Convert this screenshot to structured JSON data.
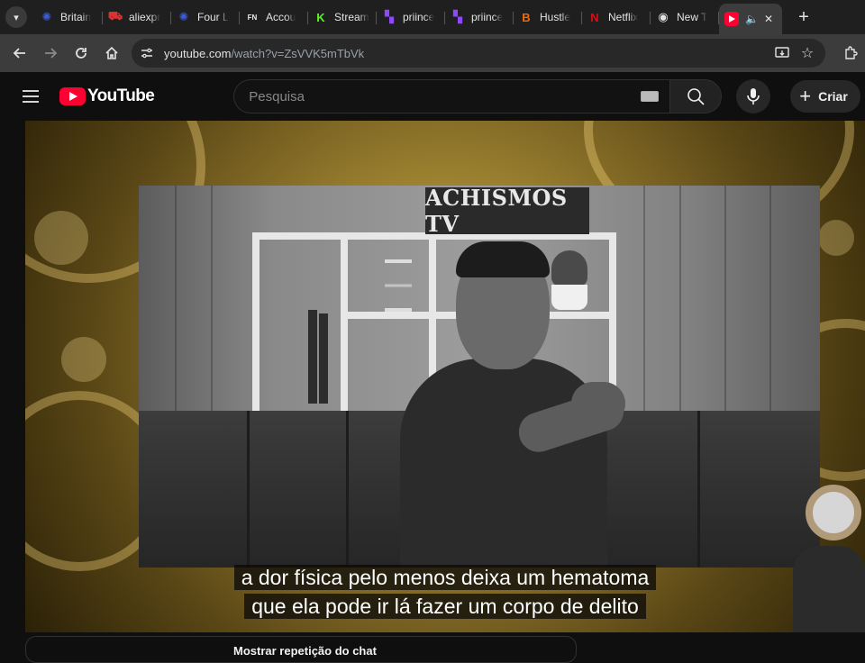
{
  "browser": {
    "tabs": [
      {
        "label": "Britain",
        "favicon": "globe-icon",
        "color": "#3b5bdb"
      },
      {
        "label": "aliexpr",
        "favicon": "cart-icon",
        "color": "#e03131"
      },
      {
        "label": "Four L",
        "favicon": "globe-icon",
        "color": "#3b5bdb"
      },
      {
        "label": "Accou",
        "favicon": "fn-icon",
        "color": "#e9ecef"
      },
      {
        "label": "Stream",
        "favicon": "kick-icon",
        "color": "#53fc18"
      },
      {
        "label": "priince",
        "favicon": "twitch-icon",
        "color": "#9146ff"
      },
      {
        "label": "priince",
        "favicon": "twitch-icon",
        "color": "#9146ff"
      },
      {
        "label": "Hustle",
        "favicon": "blogger-icon",
        "color": "#f76707"
      },
      {
        "label": "Netflix",
        "favicon": "netflix-icon",
        "color": "#e50914"
      },
      {
        "label": "New T",
        "favicon": "chrome-icon",
        "color": "#e3e3e3"
      }
    ],
    "active_tab": {
      "favicon": "youtube-icon",
      "color": "#ff0033"
    },
    "url_host": "youtube.com",
    "url_path": "/watch?v=ZsVVK5mTbVk"
  },
  "youtube": {
    "logo_text": "YouTube",
    "search_placeholder": "Pesquisa",
    "create_label": "Criar"
  },
  "video": {
    "sign_text": "ACHISMOS TV",
    "subtitle_line1": "a dor física pelo menos deixa um hematoma",
    "subtitle_line2": "que ela pode ir lá fazer um corpo de delito"
  },
  "chat": {
    "label": "Mostrar repetição do chat"
  }
}
